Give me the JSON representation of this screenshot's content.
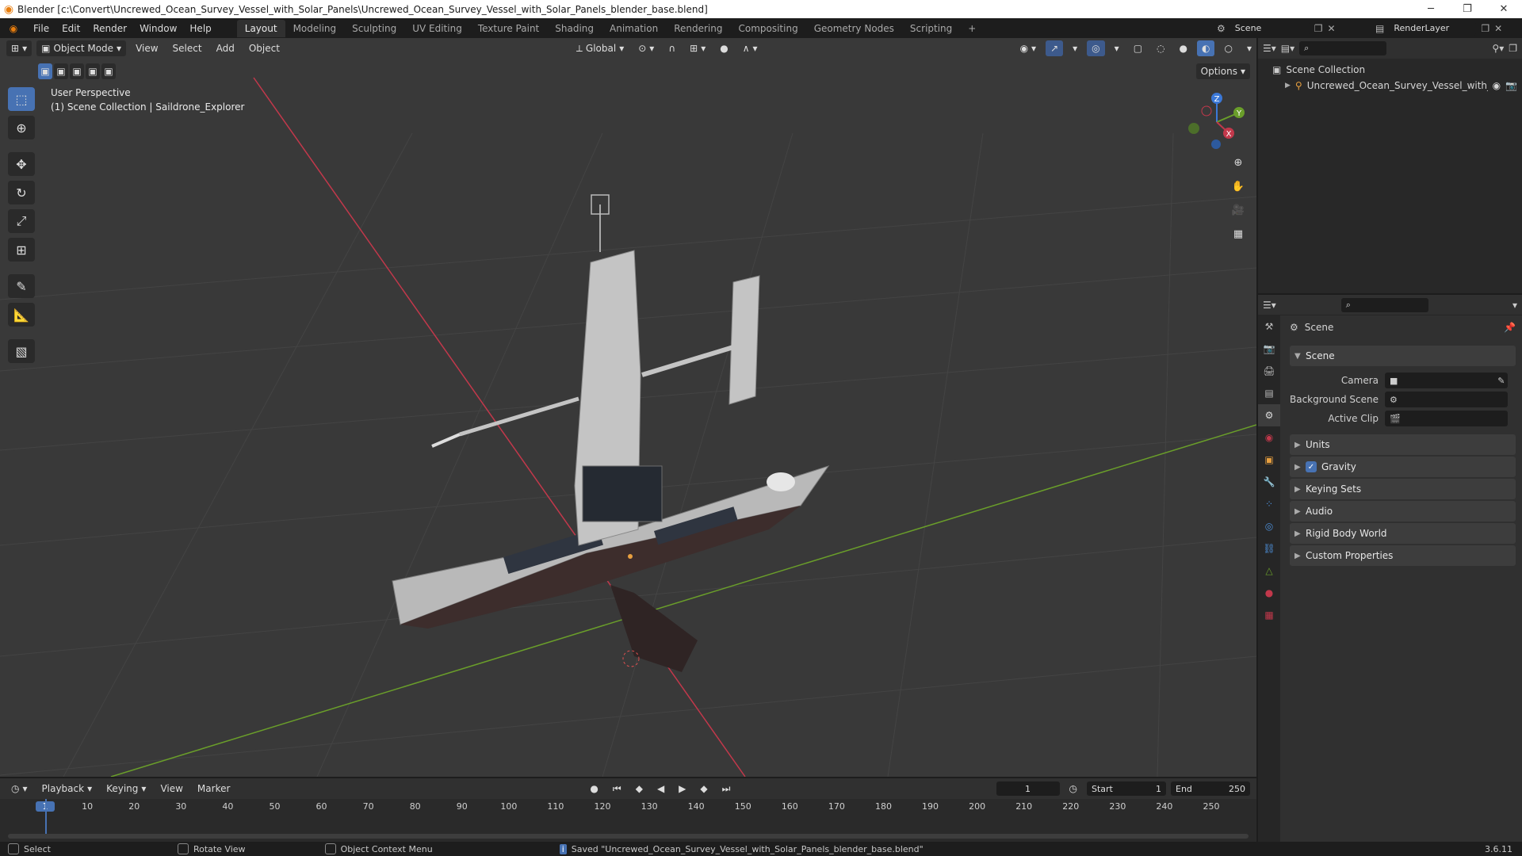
{
  "window": {
    "title": "Blender [c:\\Convert\\Uncrewed_Ocean_Survey_Vessel_with_Solar_Panels\\Uncrewed_Ocean_Survey_Vessel_with_Solar_Panels_blender_base.blend]",
    "minimize": "─",
    "restore": "❐",
    "close": "✕"
  },
  "menu": [
    "File",
    "Edit",
    "Render",
    "Window",
    "Help"
  ],
  "workspaces": [
    "Layout",
    "Modeling",
    "Sculpting",
    "UV Editing",
    "Texture Paint",
    "Shading",
    "Animation",
    "Rendering",
    "Compositing",
    "Geometry Nodes",
    "Scripting"
  ],
  "workspace_add": "+",
  "scene_selector": {
    "value": "Scene"
  },
  "renderlayer_selector": {
    "value": "RenderLayer"
  },
  "viewport": {
    "mode": "Object Mode",
    "menus": [
      "View",
      "Select",
      "Add",
      "Object"
    ],
    "orientation": "Global",
    "options_label": "Options",
    "perspective_label": "User Perspective",
    "collection_label": "(1) Scene Collection | Saildrone_Explorer",
    "gizmo_axes": {
      "x": "X",
      "y": "Y",
      "z": "Z"
    }
  },
  "outliner": {
    "search_placeholder": "",
    "root": "Scene Collection",
    "items": [
      {
        "label": "Uncrewed_Ocean_Survey_Vessel_with_"
      }
    ]
  },
  "properties": {
    "search_placeholder": "",
    "context_title": "Scene",
    "scene_panel": {
      "title": "Scene",
      "camera_label": "Camera",
      "camera_value": "",
      "background_label": "Background Scene",
      "background_value": "",
      "clip_label": "Active Clip",
      "clip_value": ""
    },
    "panels": [
      {
        "label": "Units",
        "checkbox": false
      },
      {
        "label": "Gravity",
        "checkbox": true
      },
      {
        "label": "Keying Sets",
        "checkbox": false
      },
      {
        "label": "Audio",
        "checkbox": false
      },
      {
        "label": "Rigid Body World",
        "checkbox": false
      },
      {
        "label": "Custom Properties",
        "checkbox": false
      }
    ]
  },
  "timeline": {
    "menus": [
      "Playback",
      "Keying",
      "View",
      "Marker"
    ],
    "current_frame": "1",
    "start_label": "Start",
    "start_value": "1",
    "end_label": "End",
    "end_value": "250",
    "ticks": [
      "1",
      "10",
      "20",
      "30",
      "40",
      "50",
      "60",
      "70",
      "80",
      "90",
      "100",
      "110",
      "120",
      "130",
      "140",
      "150",
      "160",
      "170",
      "180",
      "190",
      "200",
      "210",
      "220",
      "230",
      "240",
      "250"
    ]
  },
  "statusbar": {
    "select": "Select",
    "rotate": "Rotate View",
    "context_menu": "Object Context Menu",
    "message": "Saved \"Uncrewed_Ocean_Survey_Vessel_with_Solar_Panels_blender_base.blend\"",
    "version": "3.6.11"
  },
  "colors": {
    "accent": "#4772b3",
    "axis_x": "#c2384b",
    "axis_y": "#6a9e2a",
    "axis_z": "#3b78d8",
    "viewport_bg": "#393939"
  }
}
